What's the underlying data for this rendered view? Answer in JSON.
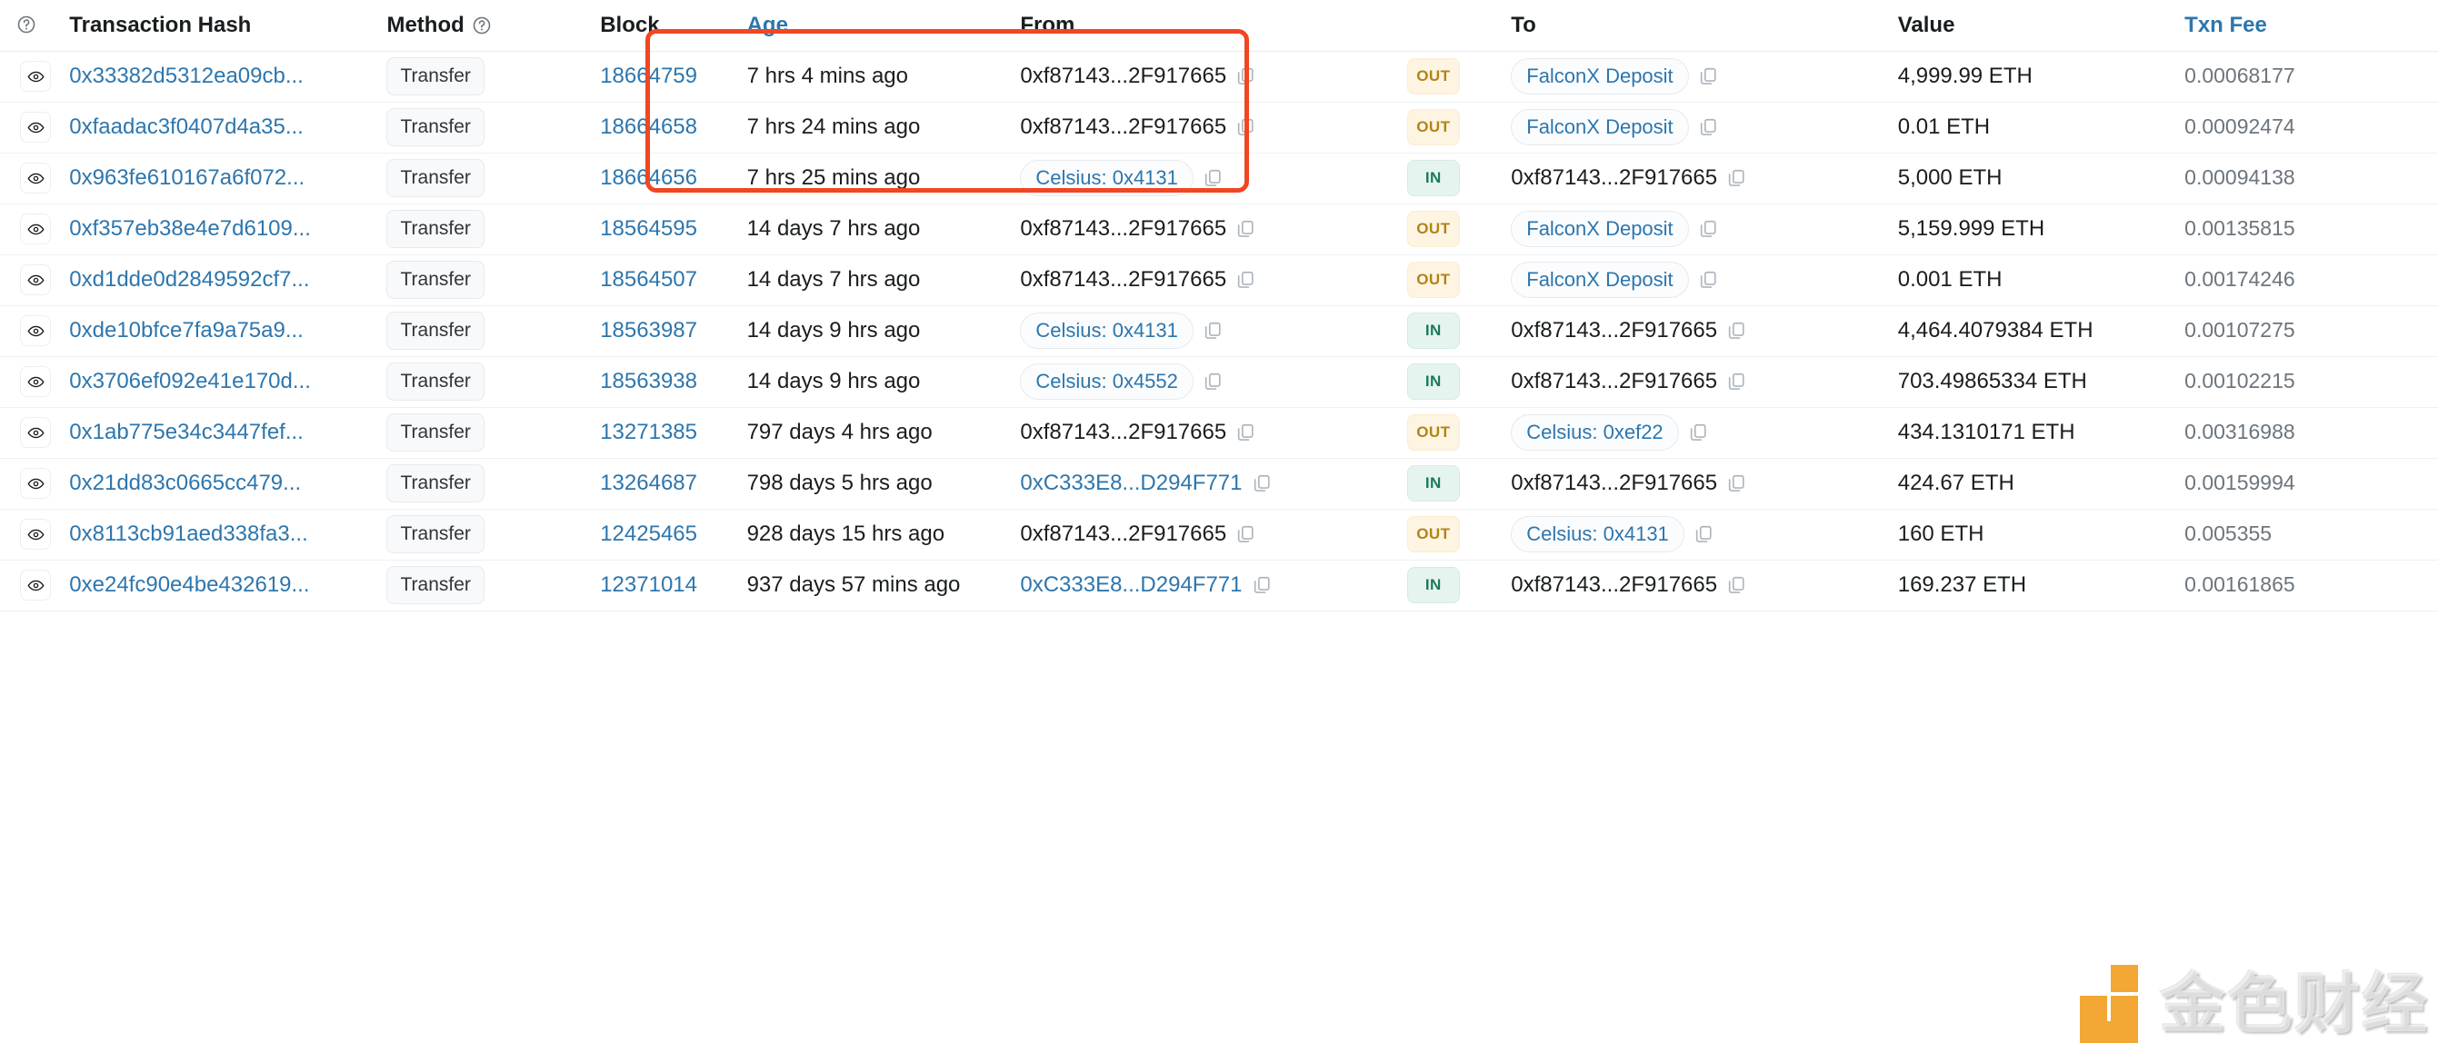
{
  "table": {
    "columns": [
      {
        "key": "eye",
        "label": "",
        "icon": "help-circle-icon",
        "link": false
      },
      {
        "key": "hash",
        "label": "Transaction Hash",
        "link": false
      },
      {
        "key": "method",
        "label": "Method",
        "icon": "help-circle-icon",
        "link": false
      },
      {
        "key": "block",
        "label": "Block",
        "link": false
      },
      {
        "key": "age",
        "label": "Age",
        "link": true
      },
      {
        "key": "from",
        "label": "From",
        "link": false
      },
      {
        "key": "dir",
        "label": "",
        "link": false
      },
      {
        "key": "to",
        "label": "To",
        "link": false
      },
      {
        "key": "value",
        "label": "Value",
        "link": false
      },
      {
        "key": "fee",
        "label": "Txn Fee",
        "link": true
      }
    ],
    "rows": [
      {
        "hash": "0x33382d5312ea09cb...",
        "method": "Transfer",
        "block": "18664759",
        "age": "7 hrs 4 mins ago",
        "from": "0xf87143...2F917665",
        "from_pill": false,
        "from_link": false,
        "direction": "OUT",
        "to": "FalconX Deposit",
        "to_pill": true,
        "to_link": true,
        "value": "4,999.99 ETH",
        "fee": "0.00068177"
      },
      {
        "hash": "0xfaadac3f0407d4a35...",
        "method": "Transfer",
        "block": "18664658",
        "age": "7 hrs 24 mins ago",
        "from": "0xf87143...2F917665",
        "from_pill": false,
        "from_link": false,
        "direction": "OUT",
        "to": "FalconX Deposit",
        "to_pill": true,
        "to_link": true,
        "value": "0.01 ETH",
        "fee": "0.00092474"
      },
      {
        "hash": "0x963fe610167a6f072...",
        "method": "Transfer",
        "block": "18664656",
        "age": "7 hrs 25 mins ago",
        "from": "Celsius: 0x4131",
        "from_pill": true,
        "from_link": true,
        "direction": "IN",
        "to": "0xf87143...2F917665",
        "to_pill": false,
        "to_link": false,
        "value": "5,000 ETH",
        "fee": "0.00094138"
      },
      {
        "hash": "0xf357eb38e4e7d6109...",
        "method": "Transfer",
        "block": "18564595",
        "age": "14 days 7 hrs ago",
        "from": "0xf87143...2F917665",
        "from_pill": false,
        "from_link": false,
        "direction": "OUT",
        "to": "FalconX Deposit",
        "to_pill": true,
        "to_link": true,
        "value": "5,159.999 ETH",
        "fee": "0.00135815"
      },
      {
        "hash": "0xd1dde0d2849592cf7...",
        "method": "Transfer",
        "block": "18564507",
        "age": "14 days 7 hrs ago",
        "from": "0xf87143...2F917665",
        "from_pill": false,
        "from_link": false,
        "direction": "OUT",
        "to": "FalconX Deposit",
        "to_pill": true,
        "to_link": true,
        "value": "0.001 ETH",
        "fee": "0.00174246"
      },
      {
        "hash": "0xde10bfce7fa9a75a9...",
        "method": "Transfer",
        "block": "18563987",
        "age": "14 days 9 hrs ago",
        "from": "Celsius: 0x4131",
        "from_pill": true,
        "from_link": true,
        "direction": "IN",
        "to": "0xf87143...2F917665",
        "to_pill": false,
        "to_link": false,
        "value": "4,464.4079384 ETH",
        "fee": "0.00107275"
      },
      {
        "hash": "0x3706ef092e41e170d...",
        "method": "Transfer",
        "block": "18563938",
        "age": "14 days 9 hrs ago",
        "from": "Celsius: 0x4552",
        "from_pill": true,
        "from_link": true,
        "direction": "IN",
        "to": "0xf87143...2F917665",
        "to_pill": false,
        "to_link": false,
        "value": "703.49865334 ETH",
        "fee": "0.00102215"
      },
      {
        "hash": "0x1ab775e34c3447fef...",
        "method": "Transfer",
        "block": "13271385",
        "age": "797 days 4 hrs ago",
        "from": "0xf87143...2F917665",
        "from_pill": false,
        "from_link": false,
        "direction": "OUT",
        "to": "Celsius: 0xef22",
        "to_pill": true,
        "to_link": true,
        "value": "434.1310171 ETH",
        "fee": "0.00316988"
      },
      {
        "hash": "0x21dd83c0665cc479...",
        "method": "Transfer",
        "block": "13264687",
        "age": "798 days 5 hrs ago",
        "from": "0xC333E8...D294F771",
        "from_pill": false,
        "from_link": true,
        "direction": "IN",
        "to": "0xf87143...2F917665",
        "to_pill": false,
        "to_link": false,
        "value": "424.67 ETH",
        "fee": "0.00159994"
      },
      {
        "hash": "0x8113cb91aed338fa3...",
        "method": "Transfer",
        "block": "12425465",
        "age": "928 days 15 hrs ago",
        "from": "0xf87143...2F917665",
        "from_pill": false,
        "from_link": false,
        "direction": "OUT",
        "to": "Celsius: 0x4131",
        "to_pill": true,
        "to_link": true,
        "value": "160 ETH",
        "fee": "0.005355"
      },
      {
        "hash": "0xe24fc90e4be432619...",
        "method": "Transfer",
        "block": "12371014",
        "age": "937 days 57 mins ago",
        "from": "0xC333E8...D294F771",
        "from_pill": false,
        "from_link": true,
        "direction": "IN",
        "to": "0xf87143...2F917665",
        "to_pill": false,
        "to_link": false,
        "value": "169.237 ETH",
        "fee": "0.00161865"
      }
    ]
  },
  "annotation": {
    "highlight_color": "#f04722",
    "description": "red-rectangle-highlight"
  },
  "watermark": {
    "text": "金色财经"
  },
  "icons": {
    "eye": "eye-icon",
    "copy": "copy-icon",
    "help": "help-circle-icon"
  }
}
